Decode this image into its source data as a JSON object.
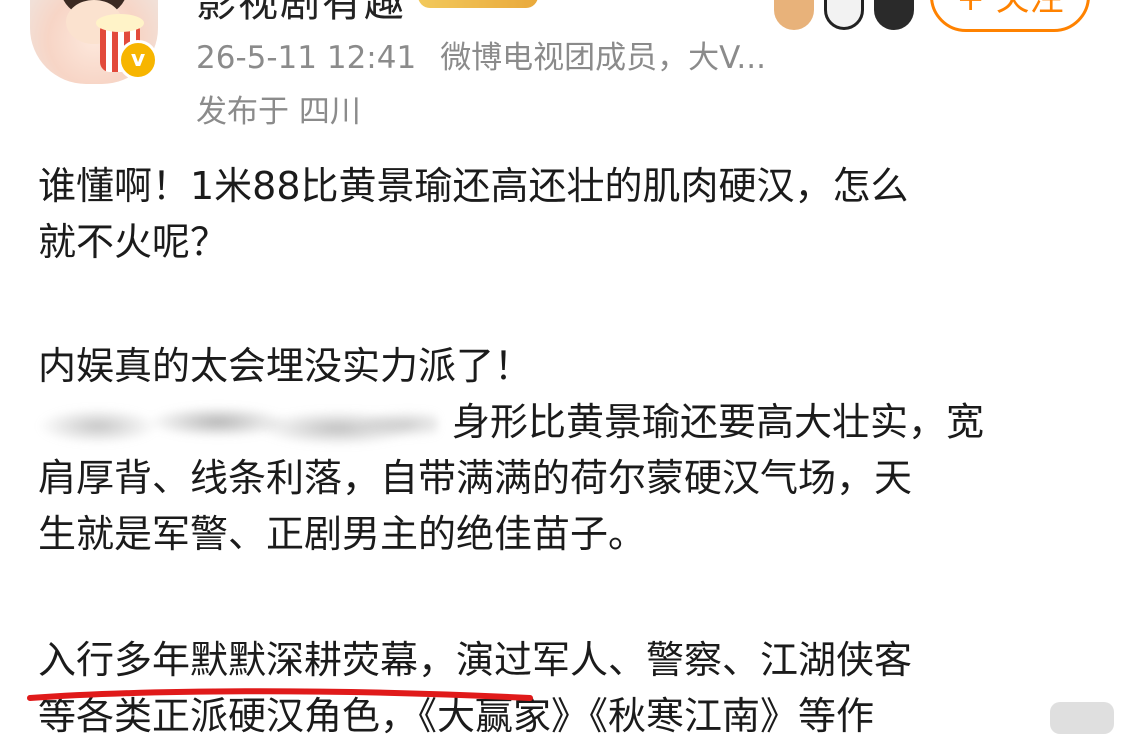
{
  "header": {
    "username": "影视剧有趣",
    "verified_mark": "v",
    "timestamp": "26-5-11 12:41",
    "author_tag": "微博电视团成员，大V...",
    "location": "发布于 四川",
    "follow_label": "+ 关注"
  },
  "post": {
    "para1_line1": "谁懂啊！1米88比黄景瑜还高还壮的肌肉硬汉，怎么",
    "para1_line2": "就不火呢？",
    "para2_line1": "内娱真的太会埋没实力派了！",
    "para2_line2": "身形比黄景瑜还要高大壮实，宽",
    "para2_line3": "肩厚背、线条利落，自带满满的荷尔蒙硬汉气场，天",
    "para2_line4": "生就是军警、正剧男主的绝佳苗子。",
    "para3_line1": "入行多年默默深耕荧幕，演过军人、警察、江湖侠客",
    "para3_line2": "等各类正派硬汉角色，《大赢家》《秋寒江南》等作"
  },
  "colors": {
    "accent_orange": "#ff8200",
    "meta_gray": "#8b8b8b",
    "underline_red": "#e01a1a",
    "badge_gold": "#f7b500"
  },
  "icons": {
    "verified": "verified-badge-icon",
    "sticker": "cat-paw-sticker"
  }
}
